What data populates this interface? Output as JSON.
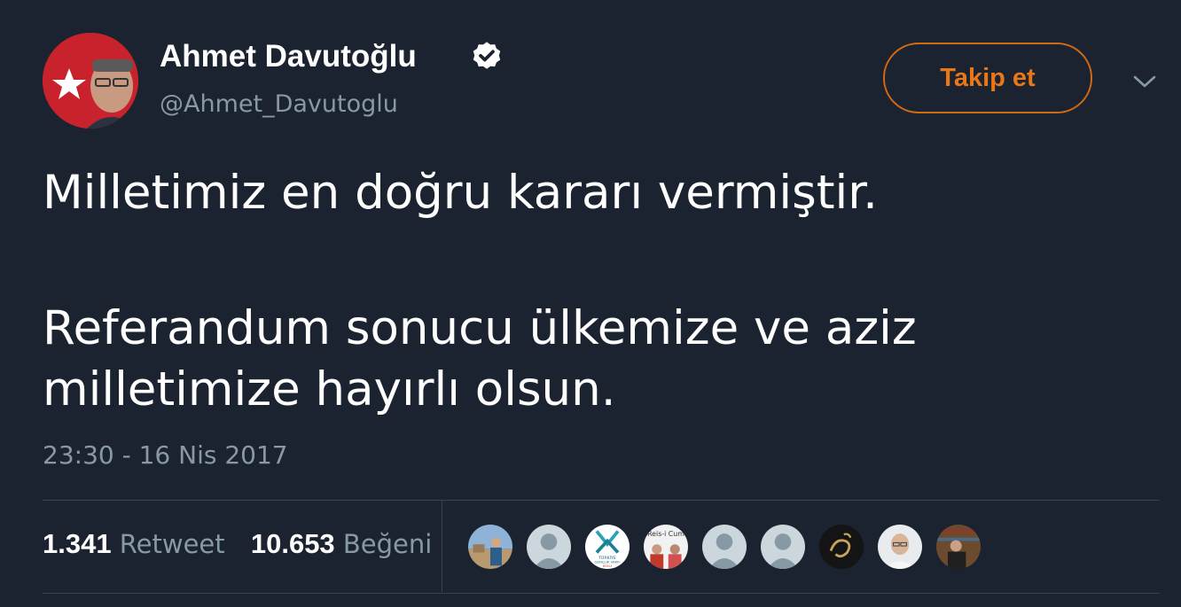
{
  "author": {
    "name": "Ahmet Davutoğlu",
    "handle": "@Ahmet_Davutoglu",
    "verified": true
  },
  "follow_button": {
    "label": "Takip et"
  },
  "tweet": {
    "lines": [
      "Milletimiz en doğru kararı vermiştir.",
      "Referandum sonucu ülkemize ve aziz",
      "milletimize hayırlı olsun."
    ],
    "timestamp": "23:30 - 16 Nis 2017"
  },
  "stats": {
    "retweets_count": "1.341",
    "retweets_label": "Retweet",
    "likes_count": "10.653",
    "likes_label": "Beğeni"
  },
  "likers": [
    {
      "icon": "photo-avatar-icon"
    },
    {
      "icon": "default-avatar-icon"
    },
    {
      "icon": "genclik-vakfi-logo-icon",
      "text": "TÜRKİYE GENÇLİK VAKFI BOLU"
    },
    {
      "icon": "photo-avatar-icon",
      "text": "Reis-i Cum"
    },
    {
      "icon": "default-avatar-icon"
    },
    {
      "icon": "default-avatar-icon"
    },
    {
      "icon": "calligraphy-avatar-icon"
    },
    {
      "icon": "photo-avatar-icon"
    },
    {
      "icon": "photo-avatar-icon"
    }
  ],
  "colors": {
    "background": "#1b2230",
    "accent": "#e8771a",
    "secondary_text": "#8899a6",
    "divider": "#38444d"
  }
}
